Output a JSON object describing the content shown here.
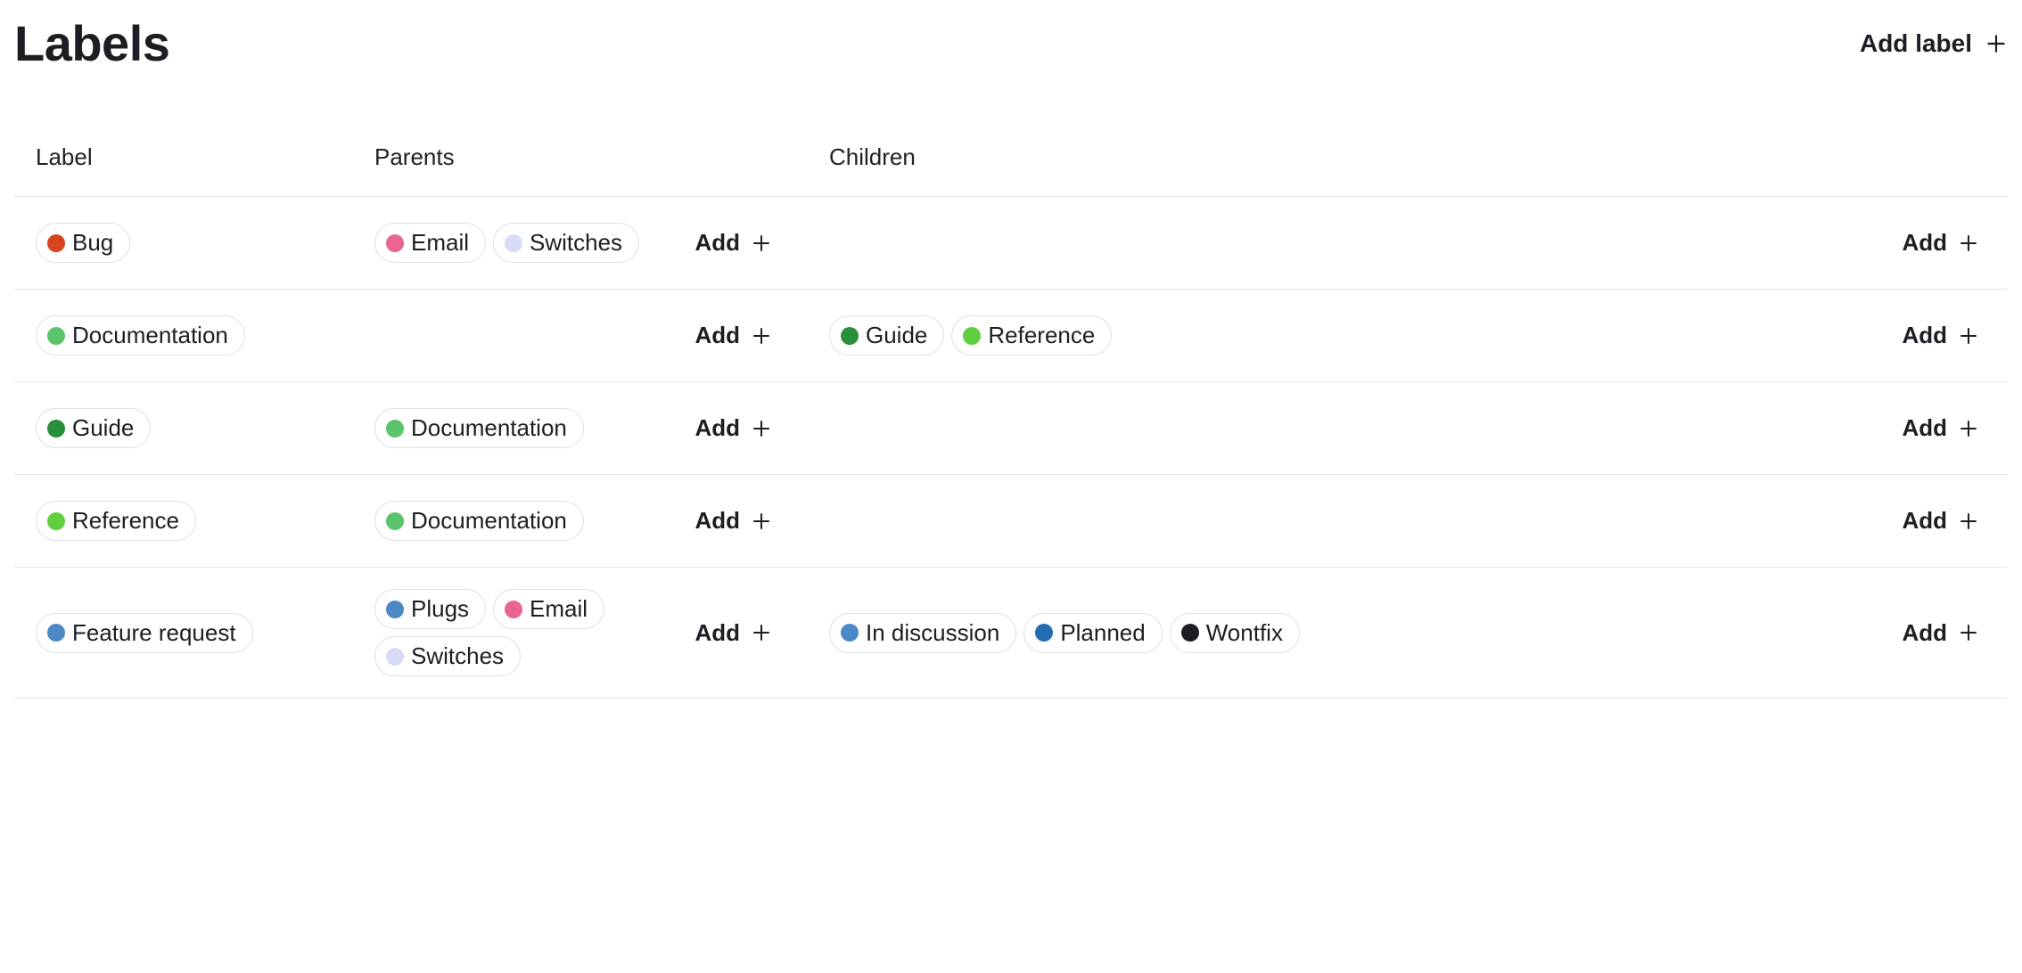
{
  "page_title": "Labels",
  "header_action": "Add label",
  "columns": {
    "label": "Label",
    "parents": "Parents",
    "children": "Children"
  },
  "add_button_text": "Add",
  "colors": {
    "orange_red": "#d9431f",
    "pink": "#e9658f",
    "lavender": "#d6dcf6",
    "green_mid": "#5ac46b",
    "green_dark": "#2a8f3a",
    "green_bright": "#5fcf3f",
    "blue_mid": "#4a88c6",
    "blue_dark": "#236db0",
    "near_black": "#1b1f23"
  },
  "rows": [
    {
      "label": {
        "text": "Bug",
        "color": "orange_red"
      },
      "parents": [
        {
          "text": "Email",
          "color": "pink"
        },
        {
          "text": "Switches",
          "color": "lavender"
        }
      ],
      "children": []
    },
    {
      "label": {
        "text": "Documentation",
        "color": "green_mid"
      },
      "parents": [],
      "children": [
        {
          "text": "Guide",
          "color": "green_dark"
        },
        {
          "text": "Reference",
          "color": "green_bright"
        }
      ]
    },
    {
      "label": {
        "text": "Guide",
        "color": "green_dark"
      },
      "parents": [
        {
          "text": "Documentation",
          "color": "green_mid"
        }
      ],
      "children": []
    },
    {
      "label": {
        "text": "Reference",
        "color": "green_bright"
      },
      "parents": [
        {
          "text": "Documentation",
          "color": "green_mid"
        }
      ],
      "children": []
    },
    {
      "label": {
        "text": "Feature request",
        "color": "blue_mid"
      },
      "parents": [
        {
          "text": "Plugs",
          "color": "blue_mid"
        },
        {
          "text": "Email",
          "color": "pink"
        },
        {
          "text": "Switches",
          "color": "lavender"
        }
      ],
      "children": [
        {
          "text": "In discussion",
          "color": "blue_mid"
        },
        {
          "text": "Planned",
          "color": "blue_dark"
        },
        {
          "text": "Wontfix",
          "color": "near_black"
        }
      ]
    }
  ]
}
